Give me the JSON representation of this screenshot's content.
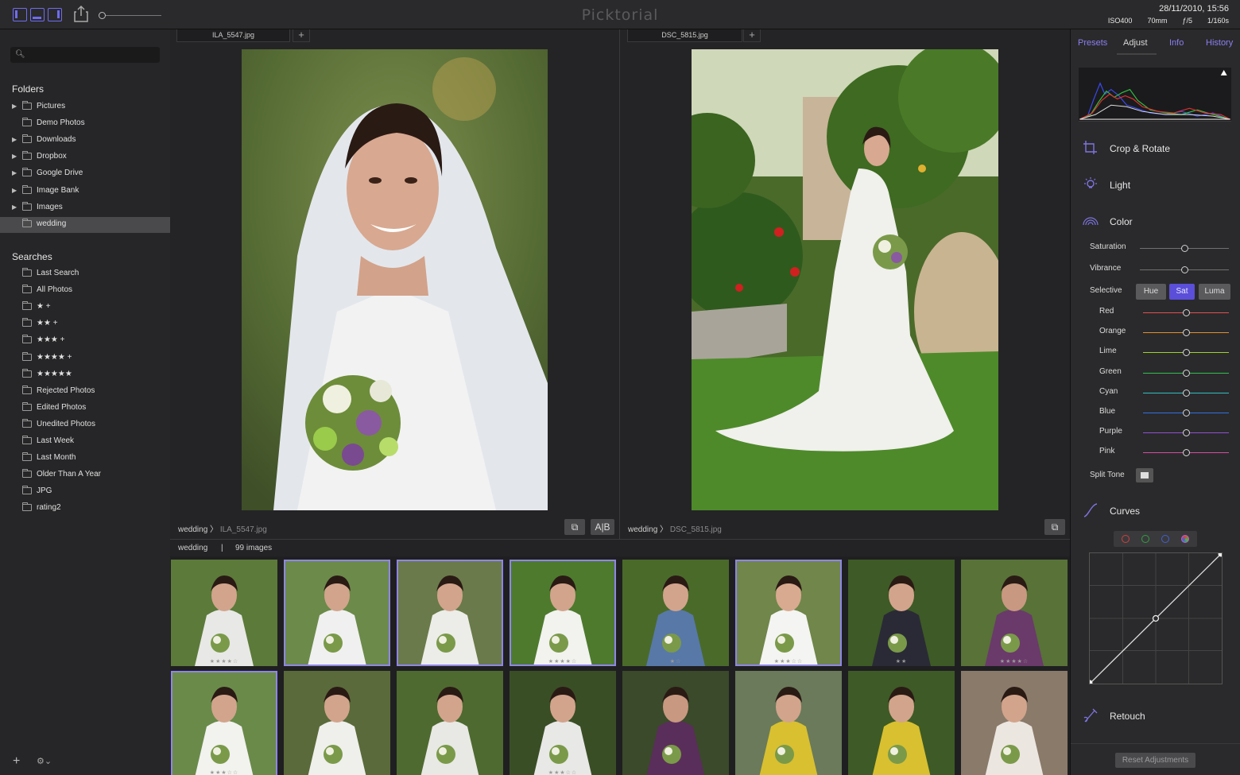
{
  "app": {
    "title": "Picktorial"
  },
  "exif": {
    "datetime": "28/11/2010, 15:56",
    "iso": "ISO400",
    "focal": "70mm",
    "aperture": "ƒ/5",
    "shutter": "1/160s"
  },
  "sidebar": {
    "search": {
      "placeholder": ""
    },
    "folders_title": "Folders",
    "folders": [
      {
        "label": "Pictures",
        "expandable": true
      },
      {
        "label": "Demo Photos",
        "expandable": false
      },
      {
        "label": "Downloads",
        "expandable": true
      },
      {
        "label": "Dropbox",
        "expandable": true
      },
      {
        "label": "Google Drive",
        "expandable": true
      },
      {
        "label": "Image Bank",
        "expandable": true
      },
      {
        "label": "Images",
        "expandable": true
      },
      {
        "label": "wedding",
        "expandable": false,
        "selected": true
      }
    ],
    "searches_title": "Searches",
    "searches": [
      "Last Search",
      "All Photos",
      "★ +",
      "★★ +",
      "★★★ +",
      "★★★★ +",
      "★★★★★",
      "Rejected Photos",
      "Edited Photos",
      "Unedited Photos",
      "Last Week",
      "Last Month",
      "Older Than A Year",
      "JPG",
      "rating2"
    ]
  },
  "viewer": {
    "left": {
      "tab": "ILA_5547.jpg",
      "folder": "wedding",
      "sep": "〉",
      "file": "ILA_5547.jpg",
      "ab_label": "A|B"
    },
    "right": {
      "tab": "DSC_5815.jpg",
      "folder": "wedding",
      "sep": "〉",
      "file": "DSC_5815.jpg"
    }
  },
  "filmstrip": {
    "folder": "wedding",
    "divider": "|",
    "count": "99 images",
    "thumbs": [
      {
        "stars": "★★★★☆",
        "selected": false
      },
      {
        "stars": "",
        "selected": true
      },
      {
        "stars": "",
        "selected": true
      },
      {
        "stars": "★★★★☆",
        "selected": true
      },
      {
        "stars": "★☆",
        "selected": false
      },
      {
        "stars": "★★★☆☆",
        "selected": true
      },
      {
        "stars": "★★",
        "selected": false
      },
      {
        "stars": "★★★★☆",
        "selected": false
      },
      {
        "stars": "★★★☆☆",
        "selected": true
      },
      {
        "stars": "",
        "selected": false
      },
      {
        "stars": "",
        "selected": false
      },
      {
        "stars": "★★★☆☆",
        "selected": false
      },
      {
        "stars": "",
        "selected": false
      },
      {
        "stars": "",
        "selected": false
      },
      {
        "stars": "",
        "selected": false
      },
      {
        "stars": "",
        "selected": false
      }
    ]
  },
  "right_panel": {
    "tabs": [
      {
        "label": "Presets",
        "active": false
      },
      {
        "label": "Adjust",
        "active": true
      },
      {
        "label": "Info",
        "active": false
      },
      {
        "label": "History",
        "active": false
      }
    ],
    "sections": {
      "crop": "Crop & Rotate",
      "light": "Light",
      "color": "Color",
      "curves": "Curves",
      "retouch": "Retouch"
    },
    "saturation": {
      "label": "Saturation",
      "value": 0.5
    },
    "vibrance": {
      "label": "Vibrance",
      "value": 0.5
    },
    "selective": {
      "label": "Selective",
      "modes": [
        "Hue",
        "Sat",
        "Luma"
      ],
      "active": "Sat"
    },
    "channels": [
      {
        "label": "Red",
        "color": "#e05050",
        "value": 0.5
      },
      {
        "label": "Orange",
        "color": "#e09030",
        "value": 0.5
      },
      {
        "label": "Lime",
        "color": "#a0d030",
        "value": 0.5
      },
      {
        "label": "Green",
        "color": "#30c050",
        "value": 0.5
      },
      {
        "label": "Cyan",
        "color": "#30c0c0",
        "value": 0.5
      },
      {
        "label": "Blue",
        "color": "#3070e0",
        "value": 0.5
      },
      {
        "label": "Purple",
        "color": "#9050d0",
        "value": 0.5
      },
      {
        "label": "Pink",
        "color": "#d050a0",
        "value": 0.5
      }
    ],
    "split_tone": "Split Tone",
    "reset_label": "Reset Adjustments"
  },
  "colors": {
    "accent": "#6f6cf0",
    "selected_tab": "#5b4ed8"
  }
}
